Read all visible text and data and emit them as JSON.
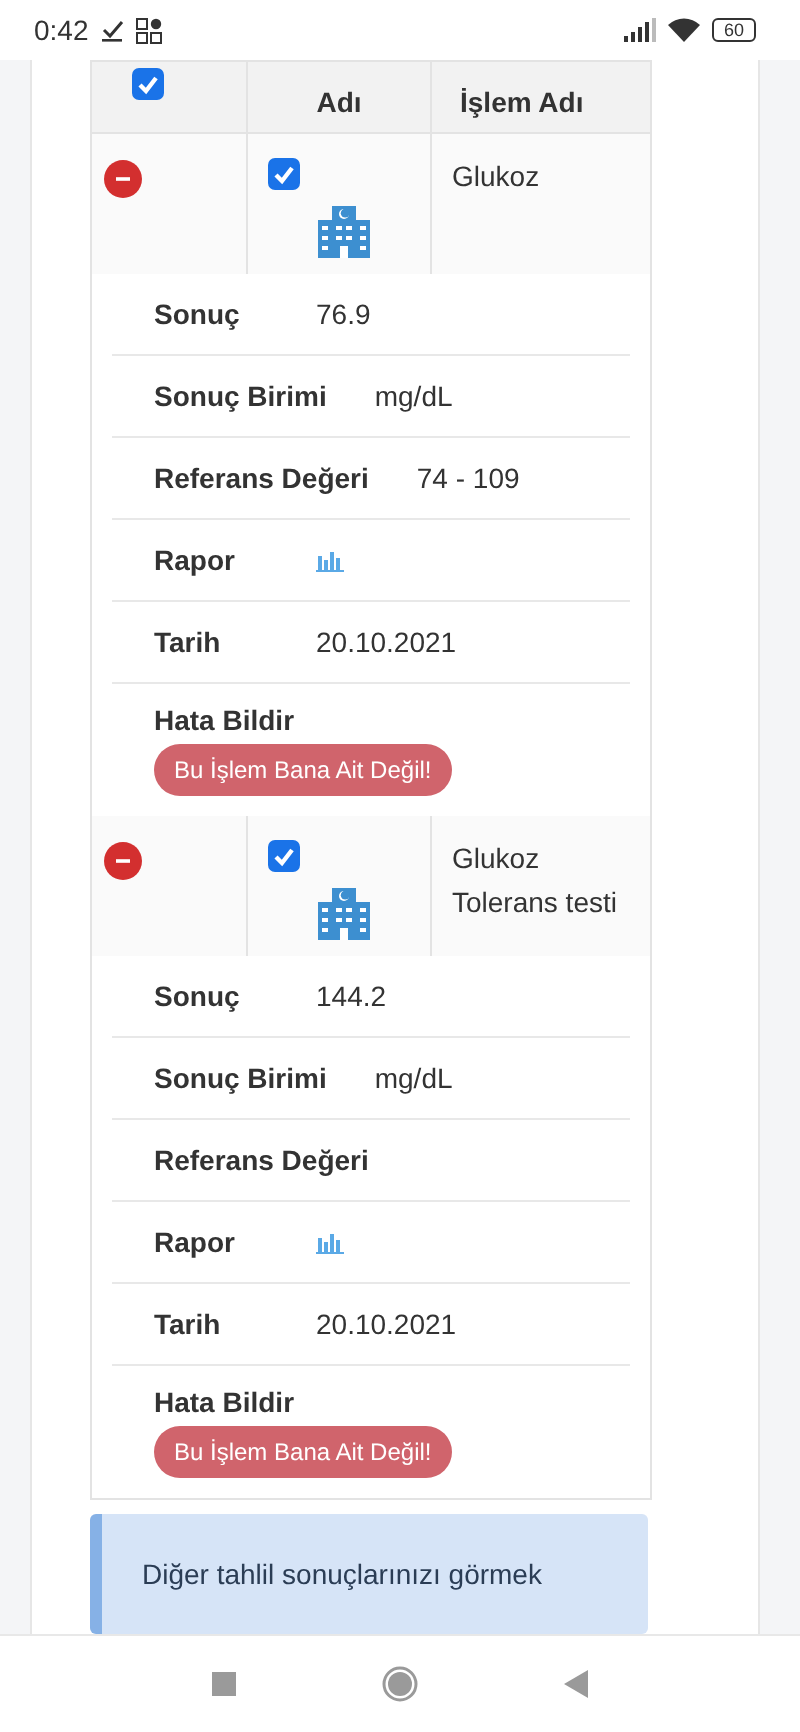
{
  "status_bar": {
    "time": "0:42",
    "battery": "60"
  },
  "table": {
    "header": {
      "checked": true,
      "columns": [
        "Adı",
        "İşlem Adı"
      ]
    },
    "rows": [
      {
        "expanded": true,
        "checked": true,
        "name": "Glukoz",
        "details": [
          {
            "label": "Sonuç",
            "value": "76.9",
            "kind": "text"
          },
          {
            "label": "Sonuç Birimi",
            "value": "mg/dL",
            "kind": "text"
          },
          {
            "label": "Referans Değeri",
            "value": "74 - 109",
            "kind": "text"
          },
          {
            "label": "Rapor",
            "kind": "chart"
          },
          {
            "label": "Tarih",
            "value": "20.10.2021",
            "kind": "text"
          }
        ],
        "report": {
          "label": "Hata Bildir",
          "button": "Bu İşlem Bana Ait Değil!"
        }
      },
      {
        "expanded": true,
        "checked": true,
        "name": "Glukoz Tolerans testi",
        "details": [
          {
            "label": "Sonuç",
            "value": "144.2",
            "kind": "text"
          },
          {
            "label": "Sonuç Birimi",
            "value": "mg/dL",
            "kind": "text"
          },
          {
            "label": "Referans Değeri",
            "kind": "text"
          },
          {
            "label": "Rapor",
            "kind": "chart"
          },
          {
            "label": "Tarih",
            "value": "20.10.2021",
            "kind": "text"
          }
        ],
        "report": {
          "label": "Hata Bildir",
          "button": "Bu İşlem Bana Ait Değil!"
        }
      }
    ]
  },
  "info": {
    "text": "Diğer tahlil sonuçlarınızı görmek"
  }
}
